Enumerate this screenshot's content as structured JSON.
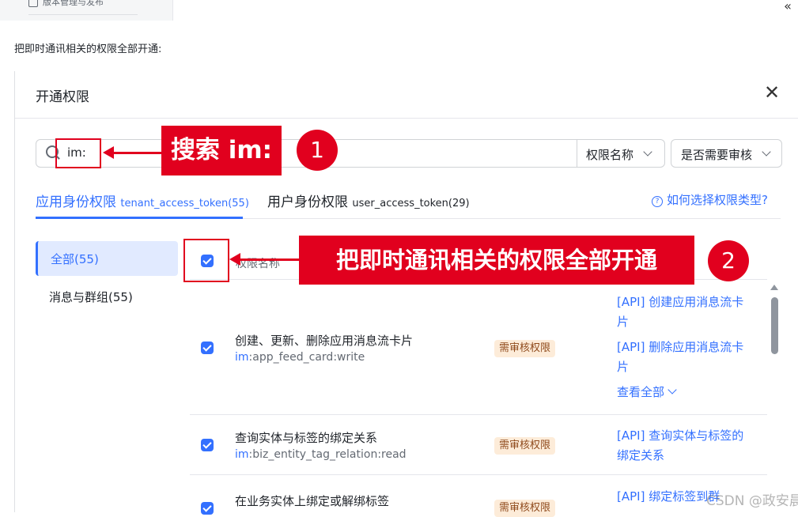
{
  "top": {
    "nav_item": "版本管理与发布",
    "collapse_text": "«"
  },
  "instruction": "把即时通讯相关的权限全部开通:",
  "dialog": {
    "title": "开通权限",
    "close": "✕",
    "search_value": "im:",
    "filter1": "权限名称",
    "filter2": "是否需要审核",
    "tabs": [
      {
        "label": "应用身份权限",
        "sub": "tenant_access_token(55)"
      },
      {
        "label": "用户身份权限",
        "sub": "user_access_token(29)"
      }
    ],
    "help": "如何选择权限类型?",
    "sidebar": [
      {
        "label": "全部(55)"
      },
      {
        "label": "消息与群组(55)"
      }
    ],
    "column_header": "权限名称",
    "rows": [
      {
        "name": "创建、更新、删除应用消息流卡片",
        "prefix": "im",
        "key": ":app_feed_card:write",
        "badge": "需审核权限",
        "apis": [
          "[API] 创建应用消息流卡片",
          "[API] 删除应用消息流卡片"
        ],
        "more": "查看全部"
      },
      {
        "name": "查询实体与标签的绑定关系",
        "prefix": "im",
        "key": ":biz_entity_tag_relation:read",
        "badge": "需审核权限",
        "apis": [
          "[API] 查询实体与标签的绑定关系"
        ]
      },
      {
        "name": "在业务实体上绑定或解绑标签",
        "badge": "需审核权限",
        "apis": [
          "[API] 绑定标签到群"
        ]
      }
    ]
  },
  "annotations": {
    "step1_label": "搜索 im:",
    "step1_num": "1",
    "step2_label": "把即时通讯相关的权限全部开通",
    "step2_num": "2"
  },
  "watermark": "CSDN @政安晨",
  "colors": {
    "accent": "#3370ff",
    "annotation_red": "#e1001e",
    "badge_bg": "#fdecd9"
  }
}
